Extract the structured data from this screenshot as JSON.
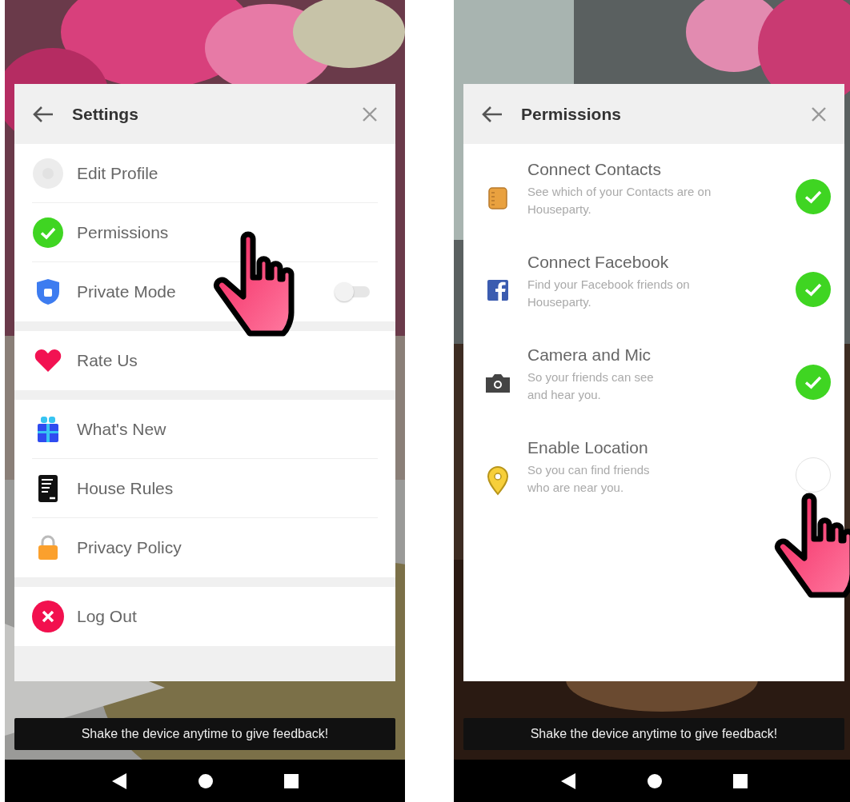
{
  "settings_screen": {
    "header": {
      "title": "Settings"
    },
    "groups": [
      [
        {
          "label": "Edit Profile",
          "kind": "avatar"
        },
        {
          "label": "Permissions",
          "kind": "check"
        },
        {
          "label": "Private Mode",
          "kind": "shield",
          "toggle": {
            "on": false
          }
        }
      ],
      [
        {
          "label": "Rate Us",
          "kind": "heart"
        }
      ],
      [
        {
          "label": "What's New",
          "kind": "gift"
        },
        {
          "label": "House Rules",
          "kind": "document"
        },
        {
          "label": "Privacy Policy",
          "kind": "lock"
        }
      ],
      [
        {
          "label": "Log Out",
          "kind": "cross"
        }
      ]
    ],
    "toast": "Shake the device anytime to give feedback!"
  },
  "permissions_screen": {
    "header": {
      "title": "Permissions"
    },
    "items": [
      {
        "title": "Connect Contacts",
        "description": "See which of your Contacts are on\nHouseparty.",
        "kind": "notebook",
        "checked": true
      },
      {
        "title": "Connect Facebook",
        "description": "Find your Facebook friends on\nHouseparty.",
        "kind": "facebook",
        "checked": true
      },
      {
        "title": "Camera and Mic",
        "description": "So your friends can see\nand hear you.",
        "kind": "camera",
        "checked": true
      },
      {
        "title": "Enable Location",
        "description": "So you can find friends\nwho are near you.",
        "kind": "pin",
        "checked": false
      }
    ],
    "toast": "Shake the device anytime to give feedback!"
  }
}
